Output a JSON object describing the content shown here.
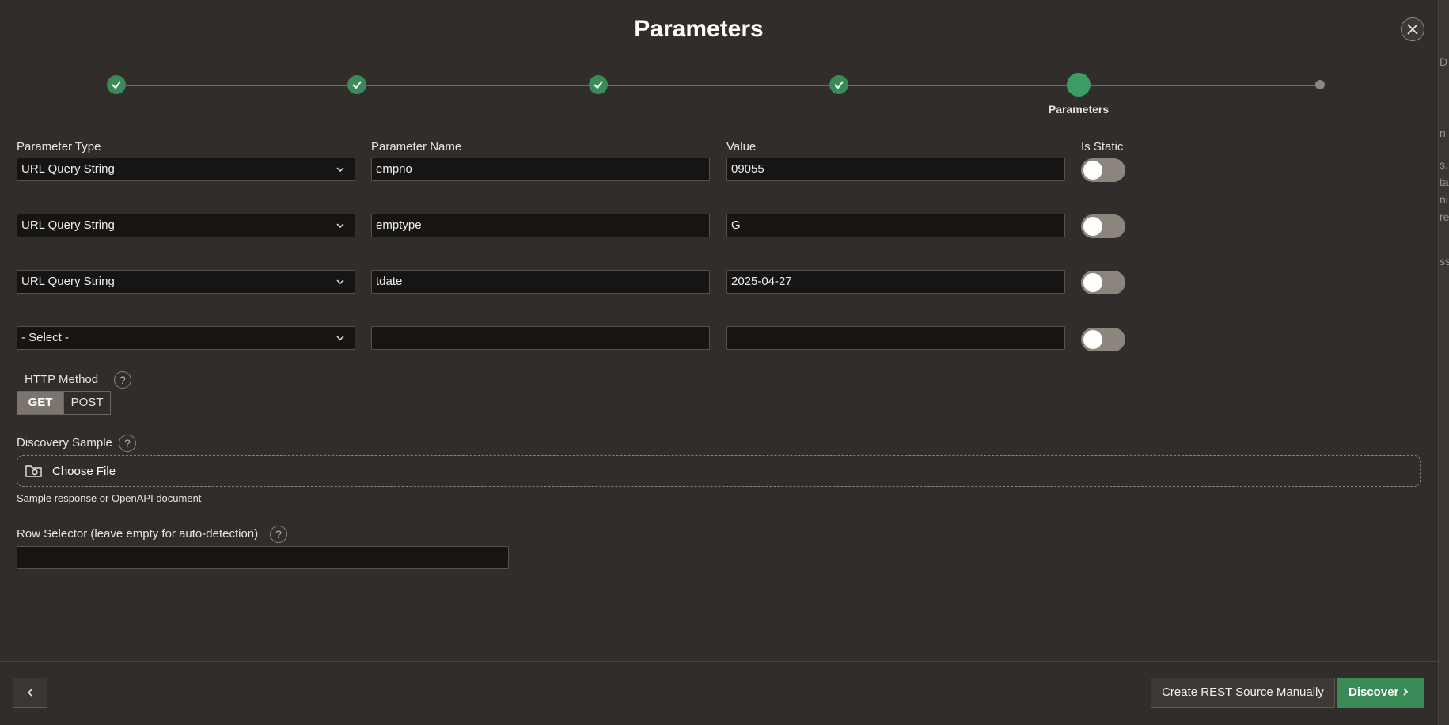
{
  "dialog": {
    "title": "Parameters",
    "close_icon": "close-icon"
  },
  "wizard": {
    "steps": [
      {
        "state": "complete",
        "icon": "check-icon"
      },
      {
        "state": "complete",
        "icon": "check-icon"
      },
      {
        "state": "complete",
        "icon": "check-icon"
      },
      {
        "state": "complete",
        "icon": "check-icon"
      },
      {
        "state": "current",
        "label": "Parameters"
      },
      {
        "state": "future"
      }
    ],
    "current_label": "Parameters"
  },
  "params": {
    "headers": {
      "type": "Parameter Type",
      "name": "Parameter Name",
      "value": "Value",
      "is_static": "Is Static"
    },
    "rows": [
      {
        "type": "URL Query String",
        "name": "empno",
        "value": "09055",
        "is_static": false
      },
      {
        "type": "URL Query String",
        "name": "emptype",
        "value": "G",
        "is_static": false
      },
      {
        "type": "URL Query String",
        "name": "tdate",
        "value": "2025-04-27",
        "is_static": false
      },
      {
        "type": "- Select -",
        "name": "",
        "value": "",
        "is_static": false
      }
    ]
  },
  "http_method": {
    "label": "HTTP Method",
    "options": [
      "GET",
      "POST"
    ],
    "selected": "GET"
  },
  "discovery": {
    "label": "Discovery Sample",
    "choose_file": "Choose File",
    "hint": "Sample response or OpenAPI document",
    "icon": "folder-camera-icon"
  },
  "row_selector": {
    "label": "Row Selector (leave empty for auto-detection)",
    "value": ""
  },
  "footer": {
    "manual_label": "Create REST Source Manually",
    "discover_label": "Discover"
  },
  "colors": {
    "background": "#312d2a",
    "field_bg": "#161513",
    "accent_green": "#3a8a57",
    "toggle_off": "#8c857e"
  }
}
